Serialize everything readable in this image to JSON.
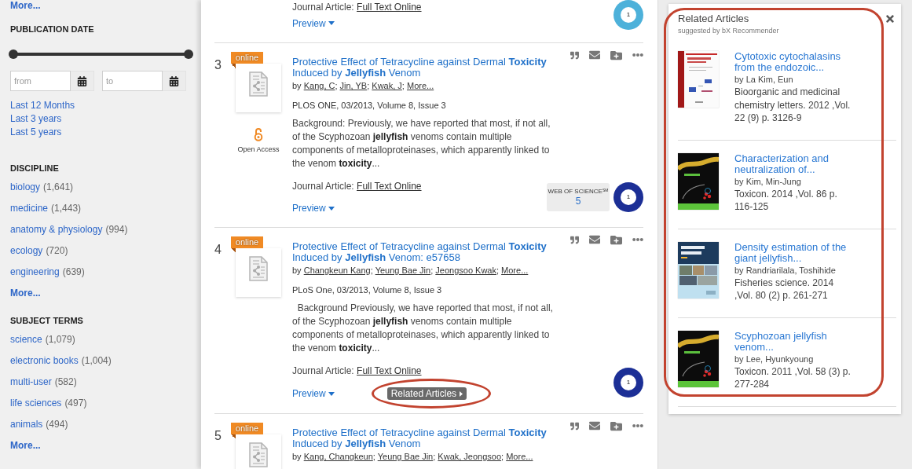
{
  "sidebar": {
    "top_more": "More...",
    "publication_date": {
      "heading": "PUBLICATION DATE",
      "slider": {
        "thumbs": [
          {
            "level": 0
          },
          {
            "level": 1
          }
        ]
      },
      "from": {
        "placeholder": "from"
      },
      "to": {
        "placeholder": "to"
      },
      "links": [
        "Last 12 Months",
        "Last 3 years",
        "Last 5 years"
      ]
    },
    "facets": [
      {
        "heading": "DISCIPLINE",
        "items": [
          {
            "label": "biology",
            "count": "(1,641)"
          },
          {
            "label": "medicine",
            "count": "(1,443)"
          },
          {
            "label": "anatomy & physiology",
            "count": "(994)"
          },
          {
            "label": "ecology",
            "count": "(720)"
          },
          {
            "label": "engineering",
            "count": "(639)"
          }
        ],
        "more": "More..."
      },
      {
        "heading": "SUBJECT TERMS",
        "items": [
          {
            "label": "science",
            "count": "(1,079)"
          },
          {
            "label": "electronic books",
            "count": "(1,004)"
          },
          {
            "label": "multi-user",
            "count": "(582)"
          },
          {
            "label": "life sciences",
            "count": "(497)"
          },
          {
            "label": "animals",
            "count": "(494)"
          }
        ],
        "more": "More..."
      }
    ]
  },
  "results": [
    {
      "format": {
        "type": "Journal Article:",
        "link": "Full Text Online"
      },
      "preview": "Preview",
      "score": {
        "value": "1",
        "color": "#4db1da"
      }
    },
    {
      "number": "3",
      "badge": "online",
      "title": "Protective Effect of Tetracycline against Dermal **Toxicity** Induced by **Jellyfish** Venom",
      "authors": {
        "prefix": "by",
        "separator": ";",
        "names": [
          "Kang, C",
          "Jin, YB",
          "Kwak, J",
          "More..."
        ]
      },
      "source": "PLOS ONE, 03/2013, Volume 8, Issue 3",
      "open_access": "Open Access",
      "abstract": "Background: Previously, we have reported that most, if not all, of the Scyphozoan **jellyfish** venoms contain multiple components of metalloproteinases, which apparently linked to the venom **toxicity**...",
      "format": {
        "type": "Journal Article:",
        "link": "Full Text Online"
      },
      "preview": "Preview",
      "citations": {
        "label": "WEB OF SCIENCE$^{SM}$",
        "count": "5"
      },
      "score": {
        "value": "1",
        "color": "#1c2f96"
      }
    },
    {
      "number": "4",
      "badge": "online",
      "title": "Protective Effect of Tetracycline against Dermal **Toxicity** Induced by **Jellyfish** Venom: e57658",
      "authors": {
        "prefix": "by",
        "separator": ";",
        "names": [
          "Changkeun Kang",
          "Yeung Bae Jin",
          "Jeongsoo Kwak",
          "More..."
        ]
      },
      "source": "PLoS One, 03/2013, Volume 8, Issue 3",
      "abstract": "  Background Previously, we have reported that most, if not all, of the Scyphozoan **jellyfish** venoms contain multiple components of metalloproteinases, which apparently linked to the venom **toxicity**...",
      "format": {
        "type": "Journal Article:",
        "link": "Full Text Online"
      },
      "preview": "Preview",
      "related": {
        "label": "Related Articles",
        "highlighted": true
      },
      "score": {
        "value": "1",
        "color": "#1c2f96"
      }
    },
    {
      "number": "5",
      "badge": "online",
      "title": "Protective Effect of Tetracycline against Dermal **Toxicity** Induced by **Jellyfish** Venom",
      "authors": {
        "prefix": "by",
        "separator": ";",
        "names": [
          "Kang, Changkeun",
          "Yeung Bae Jin",
          "Kwak, Jeongsoo",
          "More..."
        ]
      }
    }
  ],
  "related_panel": {
    "title": "Related Articles",
    "subtitle": "suggested by bX Recommender",
    "highlighted": true,
    "items": [
      {
        "kind": "chemistry",
        "title": "Cytotoxic cytochalasins from the endozoic...",
        "author": "by La Kim, Eun",
        "citation": "Bioorganic and medicinal chemistry letters. 2012 ,Vol. 22 (9) p. 3126-9"
      },
      {
        "kind": "toxin",
        "title": "Characterization and neutralization of...",
        "author": "by Kim, Min-Jung",
        "citation": "Toxicon. 2014 ,Vol. 86 p. 116-125"
      },
      {
        "kind": "fisheries",
        "title": "Density estimation of the giant jellyfish...",
        "author": "by Randriarilala, Toshihide",
        "citation": "Fisheries science. 2014 ,Vol. 80 (2) p. 261-271"
      },
      {
        "kind": "toxin",
        "title": "Scyphozoan jellyfish venom...",
        "author": "by Lee, Hyunkyoung",
        "citation": "Toxicon. 2011 ,Vol. 58 (3) p. 277-284"
      }
    ]
  }
}
